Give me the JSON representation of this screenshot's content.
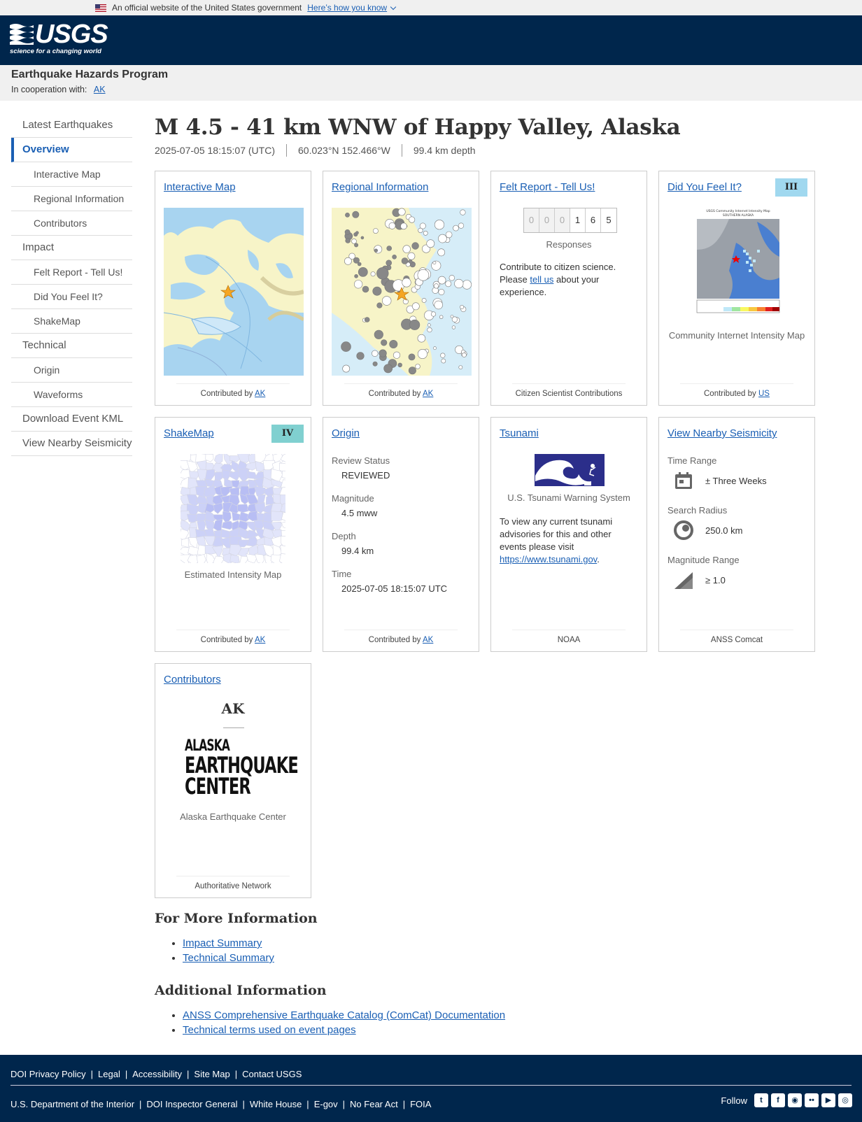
{
  "gov_banner": {
    "text": "An official website of the United States government",
    "how_link": "Here’s how you know"
  },
  "header": {
    "logo_word": "USGS",
    "logo_tagline": "science for a changing world"
  },
  "program": {
    "title": "Earthquake Hazards Program",
    "coop_label": "In cooperation with:",
    "coop_link": "AK"
  },
  "sidenav": [
    {
      "label": "Latest Earthquakes",
      "sub": false,
      "active": false
    },
    {
      "label": "Overview",
      "sub": false,
      "active": true
    },
    {
      "label": "Interactive Map",
      "sub": true,
      "active": false
    },
    {
      "label": "Regional Information",
      "sub": true,
      "active": false
    },
    {
      "label": "Contributors",
      "sub": true,
      "active": false
    },
    {
      "label": "Impact",
      "sub": false,
      "active": false
    },
    {
      "label": "Felt Report - Tell Us!",
      "sub": true,
      "active": false
    },
    {
      "label": "Did You Feel It?",
      "sub": true,
      "active": false
    },
    {
      "label": "ShakeMap",
      "sub": true,
      "active": false
    },
    {
      "label": "Technical",
      "sub": false,
      "active": false
    },
    {
      "label": "Origin",
      "sub": true,
      "active": false
    },
    {
      "label": "Waveforms",
      "sub": true,
      "active": false
    },
    {
      "label": "Download Event KML",
      "sub": false,
      "active": false
    },
    {
      "label": "View Nearby Seismicity",
      "sub": false,
      "active": false
    }
  ],
  "event": {
    "title": "M 4.5 - 41 km WNW of Happy Valley, Alaska",
    "time": "2025-07-05 18:15:07 (UTC)",
    "location": "60.023°N 152.466°W",
    "depth": "99.4 km depth"
  },
  "cards": {
    "interactive_map": {
      "title": "Interactive Map",
      "foot_prefix": "Contributed by ",
      "foot_link": "AK"
    },
    "regional": {
      "title": "Regional Information",
      "foot_prefix": "Contributed by ",
      "foot_link": "AK"
    },
    "felt": {
      "title": "Felt Report - Tell Us!",
      "digits": [
        "0",
        "0",
        "0",
        "1",
        "6",
        "5"
      ],
      "responses_label": "Responses",
      "text_before": "Contribute to citizen science. Please ",
      "text_link": "tell us",
      "text_after": " about your experience.",
      "foot": "Citizen Scientist Contributions"
    },
    "dyfi": {
      "title": "Did You Feel It?",
      "badge": "III",
      "badge_color": "#a0d8ef",
      "caption": "Community Internet Intensity Map",
      "map_title": "USGS Community Internet Intensity Map",
      "map_subtitle": "SOUTHERN ALASKA",
      "foot_prefix": "Contributed by ",
      "foot_link": "US"
    },
    "shakemap": {
      "title": "ShakeMap",
      "badge": "IV",
      "badge_color": "#80d0d0",
      "caption": "Estimated Intensity Map",
      "foot_prefix": "Contributed by ",
      "foot_link": "AK"
    },
    "origin": {
      "title": "Origin",
      "fields": [
        {
          "label": "Review Status",
          "value": "REVIEWED"
        },
        {
          "label": "Magnitude",
          "value": "4.5 mww"
        },
        {
          "label": "Depth",
          "value": "99.4 km"
        },
        {
          "label": "Time",
          "value": "2025-07-05 18:15:07 UTC"
        }
      ],
      "foot_prefix": "Contributed by ",
      "foot_link": "AK"
    },
    "tsunami": {
      "title": "Tsunami",
      "caption": "U.S. Tsunami Warning System",
      "text": "To view any current tsunami advisories for this and other events please visit ",
      "link": "https://www.tsunami.gov",
      "text_end": ".",
      "foot": "NOAA"
    },
    "nearby": {
      "title": "View Nearby Seismicity",
      "fields": [
        {
          "label": "Time Range",
          "value": "± Three Weeks",
          "icon": "calendar-icon"
        },
        {
          "label": "Search Radius",
          "value": "250.0 km",
          "icon": "radius-icon"
        },
        {
          "label": "Magnitude Range",
          "value": "≥ 1.0",
          "icon": "magnitude-icon"
        }
      ],
      "foot": "ANSS Comcat"
    },
    "contributors": {
      "title": "Contributors",
      "code": "AK",
      "logo_lines": [
        "ALASKA",
        "EARTHQUAKE",
        "CENTER"
      ],
      "caption": "Alaska Earthquake Center",
      "foot": "Authoritative Network"
    }
  },
  "more_info": {
    "heading": "For More Information",
    "links": [
      "Impact Summary",
      "Technical Summary"
    ]
  },
  "additional_info": {
    "heading": "Additional Information",
    "links": [
      "ANSS Comprehensive Earthquake Catalog (ComCat) Documentation",
      "Technical terms used on event pages"
    ]
  },
  "footer": {
    "row1": [
      "DOI Privacy Policy",
      "Legal",
      "Accessibility",
      "Site Map",
      "Contact USGS"
    ],
    "row2": [
      "U.S. Department of the Interior",
      "DOI Inspector General",
      "White House",
      "E-gov",
      "No Fear Act",
      "FOIA"
    ],
    "follow_label": "Follow",
    "social_icons": [
      "twitter-icon",
      "facebook-icon",
      "github-icon",
      "flickr-icon",
      "youtube-icon",
      "instagram-icon"
    ]
  }
}
